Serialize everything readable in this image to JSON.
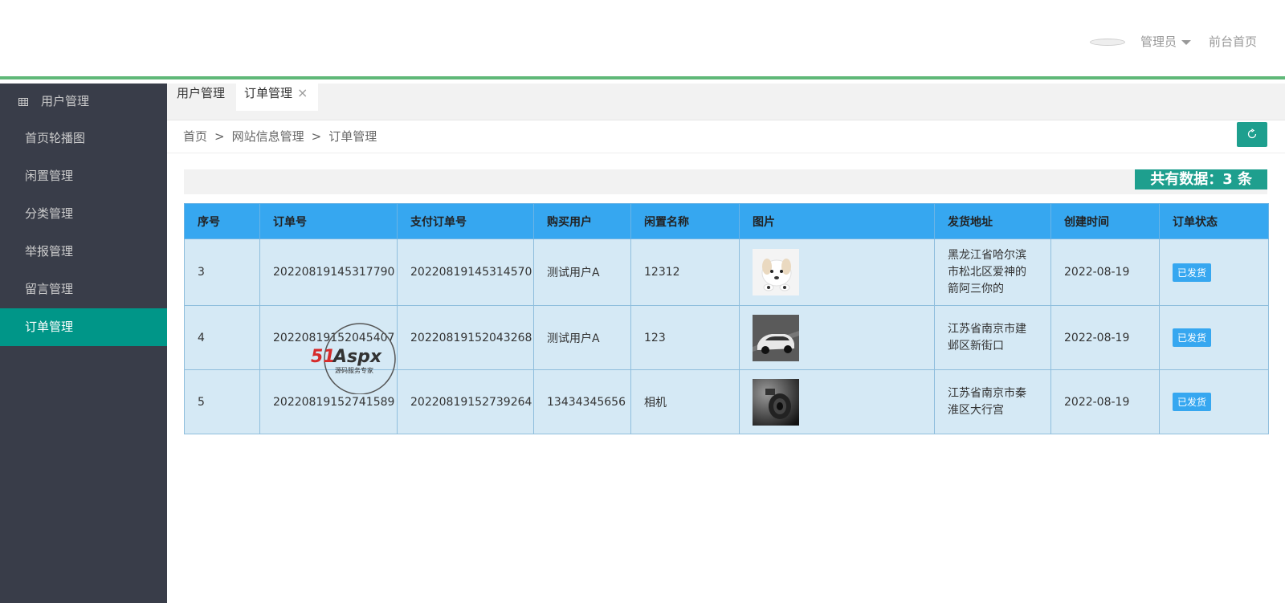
{
  "header": {
    "user_label": "管理员",
    "front_link": "前台首页"
  },
  "sidebar": {
    "group_label": "用户管理",
    "items": [
      {
        "label": "首页轮播图"
      },
      {
        "label": "闲置管理"
      },
      {
        "label": "分类管理"
      },
      {
        "label": "举报管理"
      },
      {
        "label": "留言管理"
      },
      {
        "label": "订单管理",
        "active": true
      }
    ]
  },
  "tabs": [
    {
      "label": "用户管理"
    },
    {
      "label": "订单管理",
      "active": true,
      "close": "×"
    }
  ],
  "breadcrumb": {
    "items": [
      "首页",
      "网站信息管理",
      "订单管理"
    ],
    "separator": ">"
  },
  "summary": {
    "count_label": "共有数据：3 条"
  },
  "table": {
    "columns": [
      "序号",
      "订单号",
      "支付订单号",
      "购买用户",
      "闲置名称",
      "图片",
      "发货地址",
      "创建时间",
      "订单状态"
    ],
    "rows": [
      {
        "id": "3",
        "order_no": "20220819145317790",
        "pay_no": "20220819145314570",
        "buyer": "测试用户A",
        "item_name": "12312",
        "image": "dog-photo",
        "address": "黑龙江省哈尔滨市松北区爱神的箭阿三你的",
        "created": "2022-08-19",
        "status": "已发货"
      },
      {
        "id": "4",
        "order_no": "20220819152045407",
        "pay_no": "20220819152043268",
        "buyer": "测试用户A",
        "item_name": "123",
        "image": "car-photo",
        "address": "江苏省南京市建邺区新街口",
        "created": "2022-08-19",
        "status": "已发货"
      },
      {
        "id": "5",
        "order_no": "20220819152741589",
        "pay_no": "20220819152739264",
        "buyer": "13434345656",
        "item_name": "相机",
        "image": "camera-photo",
        "address": "江苏省南京市秦淮区大行宫",
        "created": "2022-08-19",
        "status": "已发货"
      }
    ]
  },
  "watermark": {
    "brand": "51Aspx",
    "tagline": "源码服务专家"
  },
  "colors": {
    "accent": "#5fb878",
    "sidebar_bg": "#393d49",
    "active_teal": "#009688",
    "table_header": "#36a7f0",
    "table_row": "#d5e9f5"
  }
}
